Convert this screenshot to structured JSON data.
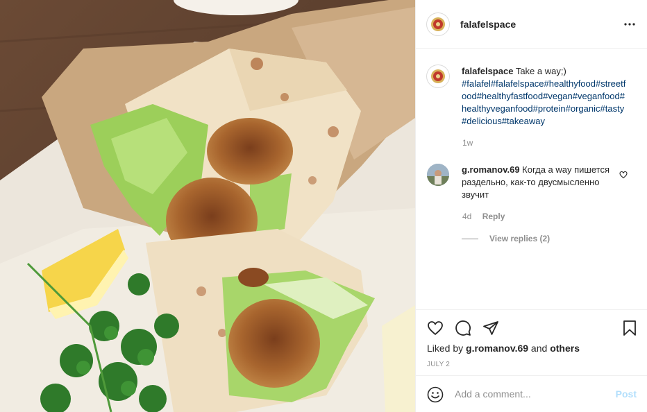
{
  "post": {
    "username": "falafelspace",
    "caption_text": " Take a way;)",
    "hashtags": [
      "#falafel",
      "#falafelspace",
      "#healthyfood",
      "#streetfood",
      "#healthyfastfood",
      "#vegan",
      "#veganfood",
      "#healthyveganfood",
      "#protein",
      "#organic",
      "#tasty",
      "#delicious",
      "#takeaway"
    ],
    "caption_age": "1w",
    "image_alt": "Falafel wraps with lettuce, lemon and parsley"
  },
  "comment": {
    "username": "g.romanov.69",
    "text": " Когда а way пишется раздельно, как-то двусмысленно звучит",
    "age": "4d",
    "reply_label": "Reply",
    "view_replies_label": "View replies (2)"
  },
  "actions": {
    "liked_by_prefix": "Liked by ",
    "liked_by_user": "g.romanov.69",
    "liked_by_and": " and ",
    "liked_by_others": "others",
    "date": "JULY 2"
  },
  "add_comment": {
    "placeholder": "Add a comment...",
    "post_label": "Post"
  },
  "icons": {
    "more": "more-horizontal-icon",
    "heart": "heart-icon",
    "comment": "comment-bubble-icon",
    "share": "paper-plane-icon",
    "save": "bookmark-icon",
    "emoji": "emoji-smile-icon",
    "comment_like": "small-heart-icon"
  },
  "colors": {
    "hashtag": "#00376b",
    "muted": "#8e8e8e",
    "post_disabled": "#b2dffc",
    "text": "#262626",
    "divider": "#efefef"
  }
}
